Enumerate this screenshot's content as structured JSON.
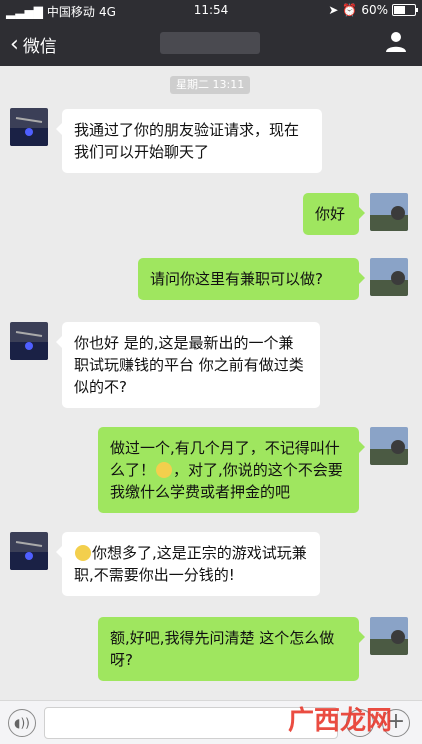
{
  "status": {
    "carrier": "中国移动",
    "network": "4G",
    "time": "11:54",
    "battery": "60%",
    "battery_level": 0.6
  },
  "nav": {
    "back_label": "微信"
  },
  "chat": {
    "timestamp": "星期二 13:11",
    "messages": [
      {
        "side": "left",
        "text": "我通过了你的朋友验证请求，现在我们可以开始聊天了"
      },
      {
        "side": "right",
        "text": "你好"
      },
      {
        "side": "right",
        "text": "请问你这里有兼职可以做?"
      },
      {
        "side": "left",
        "text": "你也好 是的,这是最新出的一个兼职试玩赚钱的平台 你之前有做过类似的不?"
      },
      {
        "side": "right",
        "text_before": "做过一个,有几个月了，不记得叫什么了！",
        "text_after": "，对了,你说的这个不会要我缴什么学费或者押金的吧"
      },
      {
        "side": "left",
        "text": "你想多了,这是正宗的游戏试玩兼职,不需要你出一分钱的!"
      },
      {
        "side": "right",
        "text": "额,好吧,我得先问清楚 这个怎么做呀?"
      }
    ]
  },
  "watermark": "广西龙网",
  "colors": {
    "bar": "#2e2e33",
    "bg": "#ebebeb",
    "sent": "#9fe65f",
    "received": "#ffffff"
  }
}
